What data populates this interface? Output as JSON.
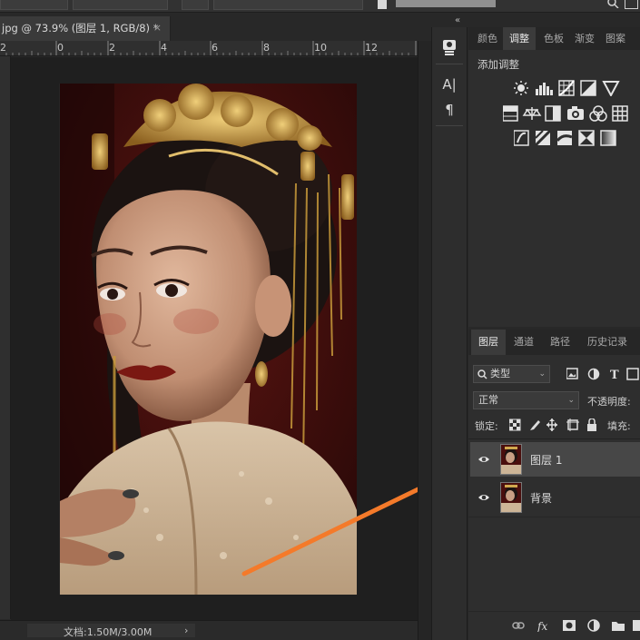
{
  "top_bar": {
    "items": [
      "",
      "",
      "",
      ""
    ]
  },
  "document": {
    "tab_title": "jpg @ 73.9% (图层 1, RGB/8) *",
    "close_glyph": "×",
    "ruler_numbers": [
      "2",
      "0",
      "2",
      "4",
      "6",
      "8",
      "10",
      "12"
    ]
  },
  "status": {
    "doc_size": "文档:1.50M/3.00M",
    "arrow": "›"
  },
  "tools": {
    "collapse_glyph": "«",
    "items": [
      {
        "icon": "library-icon",
        "glyph": "▣"
      },
      {
        "icon": "character-icon",
        "glyph": "A|"
      },
      {
        "icon": "paragraph-icon",
        "glyph": "¶"
      }
    ]
  },
  "panel_top": {
    "tabs": [
      "颜色",
      "调整",
      "色板",
      "渐变",
      "图案"
    ],
    "active_tab": "调整",
    "title": "添加调整",
    "adjustment_icons": [
      "brightness-icon",
      "levels-icon",
      "curves-icon",
      "exposure-icon",
      "vibrance-icon",
      "hue-saturation-icon",
      "color-balance-icon",
      "black-white-icon",
      "photo-filter-icon",
      "channel-mixer-icon",
      "color-lookup-icon",
      "invert-icon",
      "posterize-icon",
      "threshold-icon",
      "selective-color-icon",
      "gradient-map-icon"
    ]
  },
  "panel_layers": {
    "tabs": [
      "图层",
      "通道",
      "路径",
      "历史记录"
    ],
    "active_tab": "图层",
    "filter_kind": "类型",
    "blend_mode": "正常",
    "opacity_label": "不透明度:",
    "lock_label": "锁定:",
    "fill_label": "填充:",
    "layers": [
      {
        "name": "图层 1",
        "selected": true,
        "visible": true
      },
      {
        "name": "背景",
        "selected": false,
        "visible": true
      }
    ],
    "bottom_icons": [
      "link-icon",
      "fx-icon",
      "mask-icon",
      "adjustment-layer-icon",
      "folder-icon",
      "new-layer-icon"
    ]
  },
  "colors": {
    "accent_arrow": "#f47a2a",
    "photo_bg": "#4a0f0e"
  }
}
